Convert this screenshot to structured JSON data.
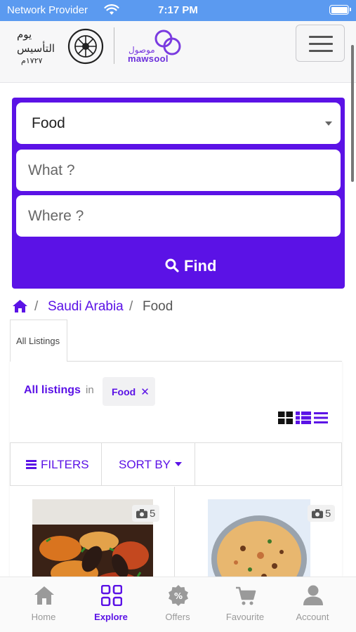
{
  "status_bar": {
    "carrier": "Network Provider",
    "time": "7:17 PM"
  },
  "header": {
    "brand_name": "mawsool",
    "brand_name_arabic": "موصول",
    "founding_logo_text": [
      "يوم",
      "التأسيس",
      "١٧٢٧م"
    ],
    "menu_icon": "hamburger-icon"
  },
  "search": {
    "category": "Food",
    "what_placeholder": "What ?",
    "where_placeholder": "Where ?",
    "find_label": "Find",
    "accent_color": "#5b12e6"
  },
  "breadcrumb": {
    "home_icon": "home-icon",
    "items": [
      "Saudi Arabia",
      "Food"
    ],
    "separator": "/"
  },
  "listings": {
    "tab_label": "All Listings",
    "summary_label": "All listings",
    "summary_in": "in",
    "filter_chip": "Food",
    "filter_chip_close": "✕",
    "toolbar": {
      "filters_label": "FILTERS",
      "sort_label": "SORT BY"
    },
    "cards": [
      {
        "photo_count": "5"
      },
      {
        "photo_count": "5"
      }
    ]
  },
  "tabbar": {
    "items": [
      {
        "label": "Home",
        "icon": "home-icon"
      },
      {
        "label": "Explore",
        "icon": "grid-icon",
        "active": true
      },
      {
        "label": "Offers",
        "icon": "percent-badge-icon"
      },
      {
        "label": "Favourite",
        "icon": "cart-icon"
      },
      {
        "label": "Account",
        "icon": "user-icon"
      }
    ]
  }
}
